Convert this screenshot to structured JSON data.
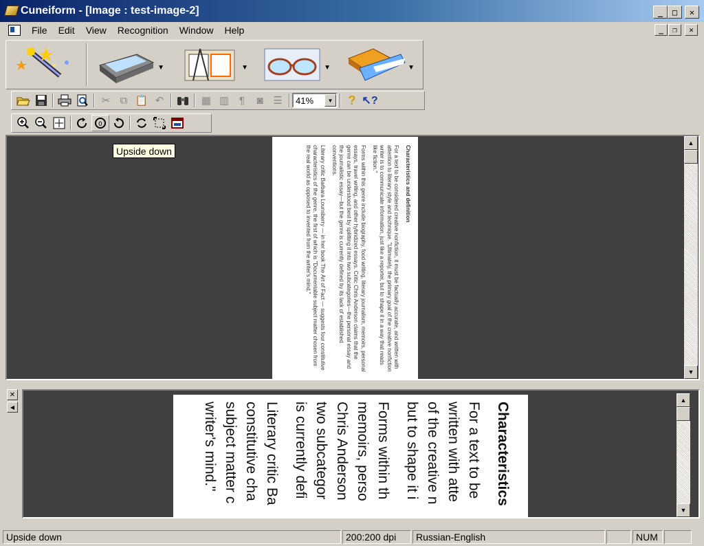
{
  "window": {
    "title": "Cuneiform - [Image : test-image-2]"
  },
  "menu": [
    "File",
    "Edit",
    "View",
    "Recognition",
    "Window",
    "Help"
  ],
  "toolbar": {
    "zoom_value": "41%"
  },
  "tooltip": "Upside down",
  "document": {
    "heading": "Characteristics and definition",
    "paragraphs": [
      "For a text to be considered creative nonfiction, it must be factually accurate, and written with attention to literary style and technique. \"Ultimately, the primary goal of the creative nonfiction writer is to communicate information, just like a reporter, but to shape it in a way that reads like fiction.\"",
      "Forms within this genre include biography, food writing, literary journalism, memoirs, personal essays, travel writing, and other hybridized essays. Critic Chris Anderson claims that the genre can be understood best by splitting it into two subcategories—the personal essay and the journalistic essay—but the genre is currently defined by its lack of established conventions.",
      "Literary critic Barbara Lounsberry — in her book The Art of Fact — suggests four constitutive characteristics of the genre, the first of which is \"Documentable subject matter chosen from the real world as opposed to invented from the writer's mind.\""
    ],
    "zoom_lines": [
      "Characteristics",
      "For a text to be",
      "written with atte",
      "of the creative n",
      "but to shape it i",
      "Forms within th",
      "memoirs, perso",
      "Chris Anderson",
      "two subcategor",
      "is currently defi",
      "Literary critic Ba",
      "constitutive cha",
      "subject matter c",
      "writer's mind.\""
    ]
  },
  "status": {
    "message": "Upside down",
    "resolution": "200:200 dpi",
    "language": "Russian-English",
    "num": "NUM"
  }
}
